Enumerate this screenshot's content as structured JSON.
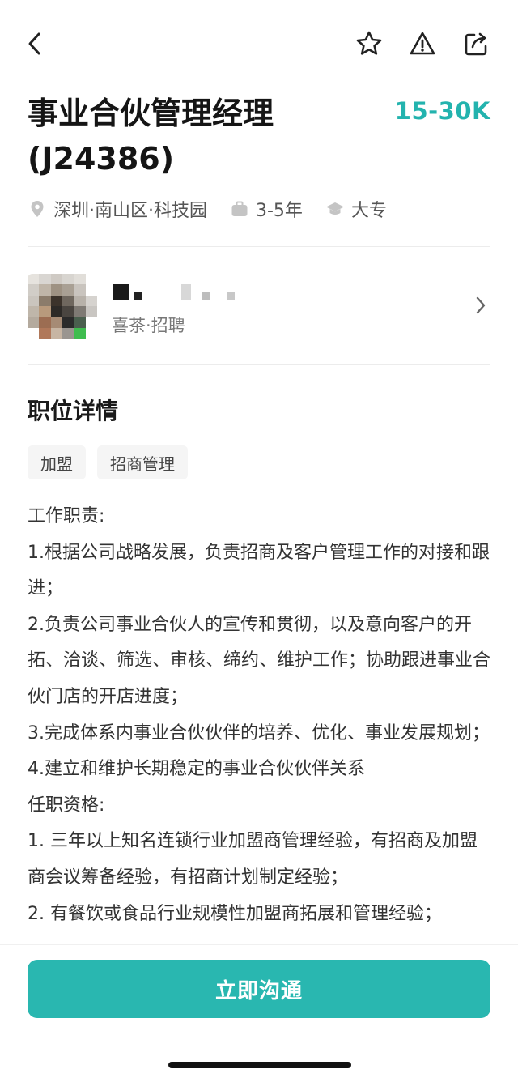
{
  "nav": {
    "back_icon": "chevron-left-icon",
    "favorite_icon": "star-icon",
    "report_icon": "warning-icon",
    "share_icon": "share-icon"
  },
  "job": {
    "title": "事业合伙管理经理(J24386)",
    "salary": "15-30K",
    "location": "深圳·南山区·科技园",
    "experience": "3-5年",
    "education": "大专"
  },
  "recruiter": {
    "company": "喜茶·招聘"
  },
  "details": {
    "section_title": "职位详情",
    "tags": [
      "加盟",
      "招商管理"
    ],
    "lines": [
      "工作职责:",
      "1.根据公司战略发展，负责招商及客户管理工作的对接和跟进；",
      "2.负责公司事业合伙人的宣传和贯彻，以及意向客户的开拓、洽谈、筛选、审核、缔约、维护工作；协助跟进事业合伙门店的开店进度；",
      "3.完成体系内事业合伙伙伴的培养、优化、事业发展规划；",
      "4.建立和维护长期稳定的事业合伙伙伴关系",
      "任职资格:",
      "1. 三年以上知名连锁行业加盟商管理经验，有招商及加盟商会议筹备经验，有招商计划制定经验；",
      "2. 有餐饮或食品行业规模性加盟商拓展和管理经验；"
    ]
  },
  "cta": {
    "label": "立即沟通"
  },
  "colors": {
    "accent": "#29b7b0",
    "salary": "#23b3ae"
  }
}
